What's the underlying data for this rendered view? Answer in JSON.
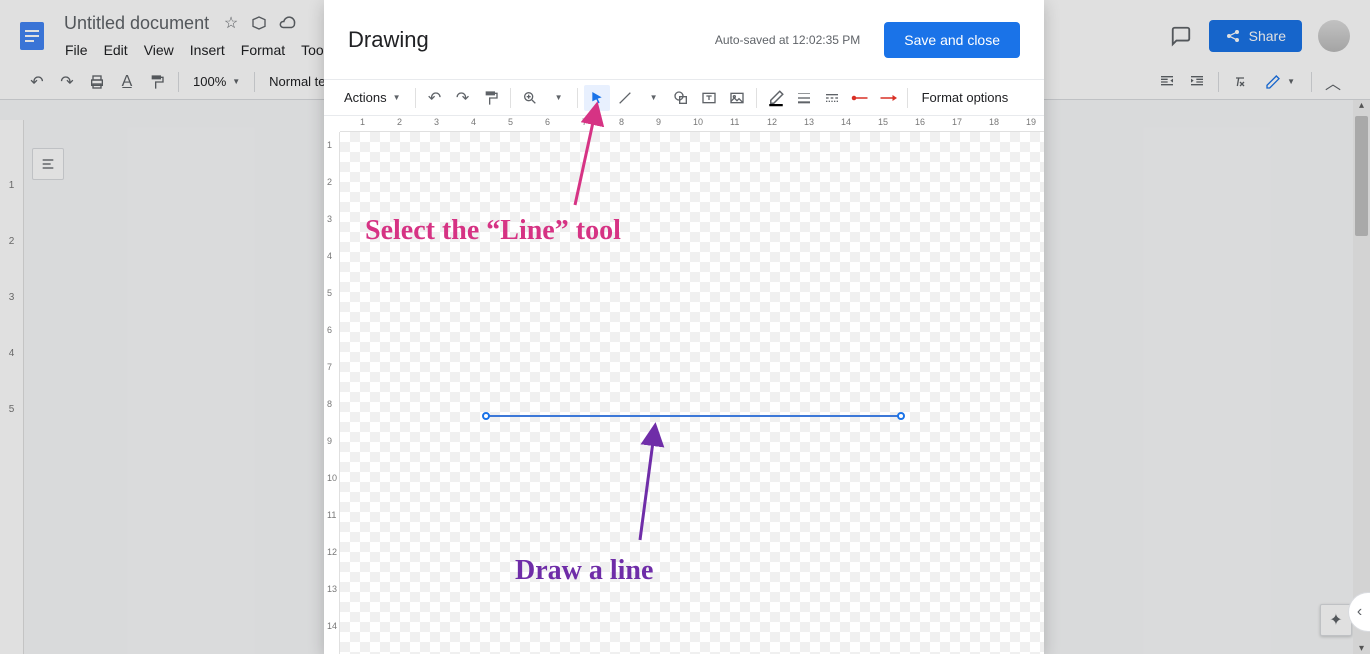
{
  "docs": {
    "title": "Untitled document",
    "menus": [
      "File",
      "Edit",
      "View",
      "Insert",
      "Format",
      "Tools"
    ],
    "zoom": "100%",
    "style": "Normal text",
    "share": "Share"
  },
  "drawing": {
    "title": "Drawing",
    "status": "Auto-saved at 12:02:35 PM",
    "save": "Save and close",
    "actions": "Actions",
    "format_options": "Format options",
    "ruler_h": [
      "1",
      "2",
      "3",
      "4",
      "5",
      "6",
      "7",
      "8",
      "9",
      "10",
      "11",
      "12",
      "13",
      "14",
      "15",
      "16",
      "17",
      "18",
      "19"
    ],
    "ruler_v": [
      "1",
      "2",
      "3",
      "4",
      "5",
      "6",
      "7",
      "8",
      "9",
      "10",
      "11",
      "12",
      "13",
      "14"
    ]
  },
  "side_ruler": [
    "1",
    "2",
    "3",
    "4",
    "5"
  ],
  "annotations": {
    "line_tool": "Select the “Line” tool",
    "draw_line": "Draw a line"
  }
}
